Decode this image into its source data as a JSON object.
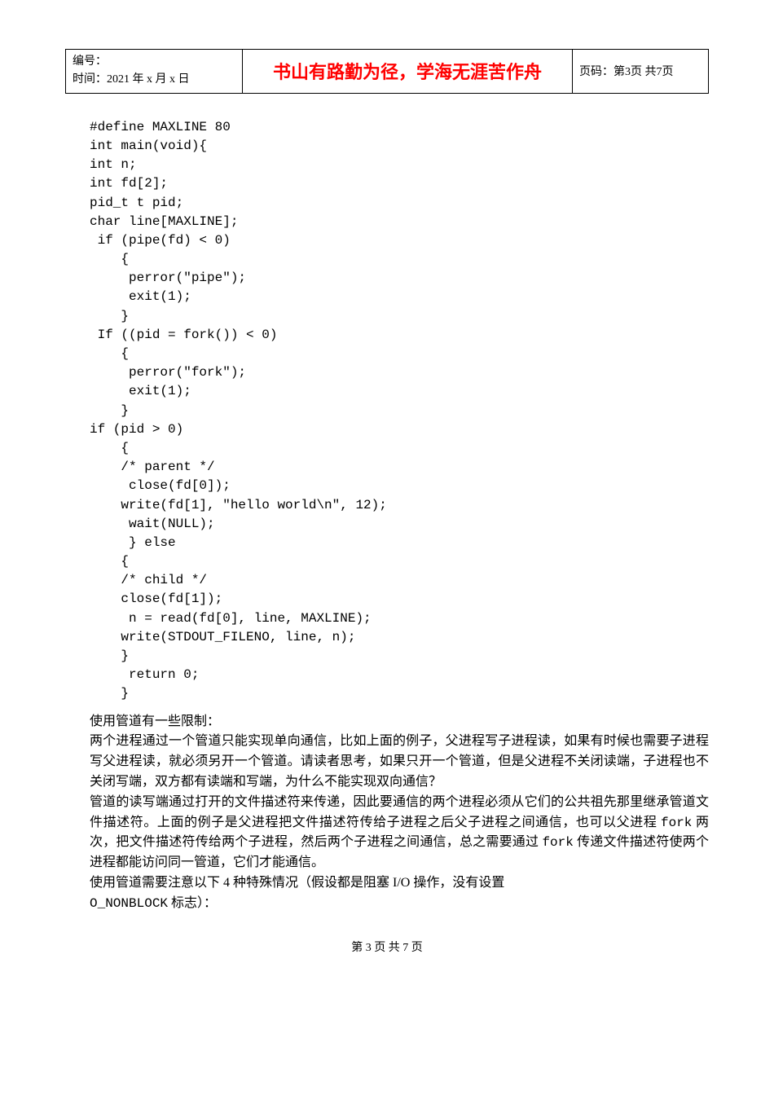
{
  "header": {
    "left_line1": "编号：",
    "left_line2": "时间：2021 年 x 月 x 日",
    "center": "书山有路勤为径，学海无涯苦作舟",
    "right": "页码：第3页 共7页"
  },
  "code": "#define MAXLINE 80\nint main(void){\nint n;\nint fd[2];\npid_t t pid;\nchar line[MAXLINE];\n if (pipe(fd) < 0)\n    {\n     perror(\"pipe\");\n     exit(1);\n    }\n If ((pid = fork()) < 0)\n    {\n     perror(\"fork\");\n     exit(1);\n    }\nif (pid > 0)\n    {\n    /* parent */\n     close(fd[0]);\n    write(fd[1], \"hello world\\n\", 12);\n     wait(NULL);\n     } else\n    {\n    /* child */\n    close(fd[1]);\n     n = read(fd[0], line, MAXLINE);\n    write(STDOUT_FILENO, line, n);\n    }\n     return 0;\n    }",
  "body": {
    "p1": "使用管道有一些限制：",
    "p2": "两个进程通过一个管道只能实现单向通信，比如上面的例子，父进程写子进程读，如果有时候也需要子进程写父进程读，就必须另开一个管道。请读者思考，如果只开一个管道，但是父进程不关闭读端，子进程也不关闭写端，双方都有读端和写端，为什么不能实现双向通信？",
    "p3_a": "管道的读写端通过打开的文件描述符来传递，因此要通信的两个进程必须从它们的公共祖先那里继承管道文件描述符。上面的例子是父进程把文件描述符传给子进程之后父子进程之间通信，也可以父进程 ",
    "p3_b": " 两次，把文件描述符传给两个子进程，然后两个子进程之间通信，总之需要通过 ",
    "p3_c": " 传递文件描述符使两个进程都能访问同一管道，它们才能通信。",
    "fork1": "fork",
    "fork2": "fork",
    "p4_a": "使用管道需要注意以下 4 种特殊情况（假设都是阻塞 I/O 操作，没有设置",
    "p4_b": "O_NONBLOCK",
    "p4_c": " 标志）："
  },
  "footer": "第 3 页 共 7 页"
}
